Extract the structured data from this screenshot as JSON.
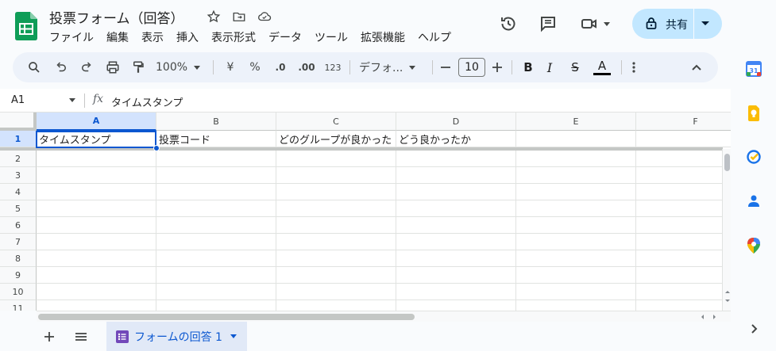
{
  "doc": {
    "title": "投票フォーム（回答）"
  },
  "menu": [
    "ファイル",
    "編集",
    "表示",
    "挿入",
    "表示形式",
    "データ",
    "ツール",
    "拡張機能",
    "ヘルプ"
  ],
  "share": {
    "label": "共有"
  },
  "toolbar": {
    "zoom": "100%",
    "currency": "¥",
    "percent": "%",
    "dec_decrease": ".0",
    "dec_increase": ".00",
    "number_format": "123",
    "font": "デフォ...",
    "font_size": "10",
    "bold": "B",
    "italic": "I",
    "strike": "S",
    "text_color": "A"
  },
  "formula": {
    "cell_ref": "A1",
    "fx": "fx",
    "value": "タイムスタンプ"
  },
  "grid": {
    "columns": [
      "A",
      "B",
      "C",
      "D",
      "E",
      "F"
    ],
    "rows": [
      "1",
      "2",
      "3",
      "4",
      "5",
      "6",
      "7",
      "8",
      "9",
      "10",
      "11"
    ],
    "row1": [
      "タイムスタンプ",
      "投票コード",
      "どのグループが良かった",
      "どう良かったか",
      "",
      ""
    ]
  },
  "sheets": {
    "active_tab": "フォームの回答 1"
  },
  "colors": {
    "accent": "#0b57d0",
    "share_bg": "#c2e7ff",
    "sheets_green": "#0f9d58",
    "forms_purple": "#7248b9"
  }
}
